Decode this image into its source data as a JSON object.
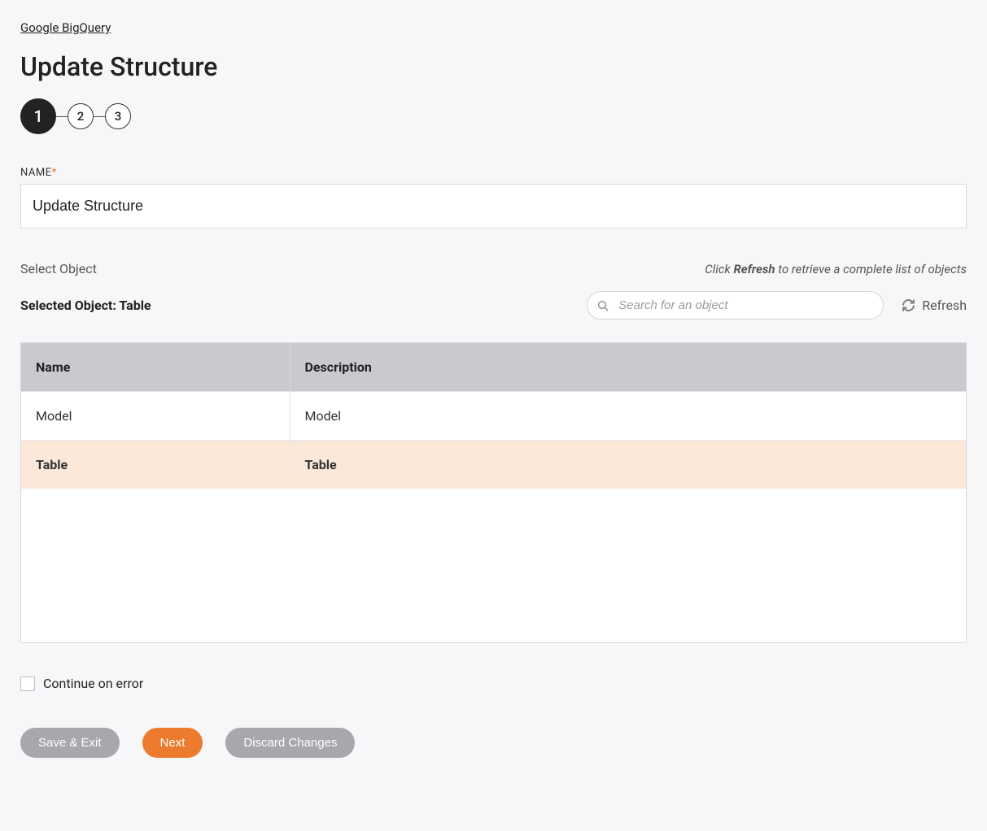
{
  "breadcrumb": "Google BigQuery",
  "page_title": "Update Structure",
  "stepper": {
    "steps": [
      "1",
      "2",
      "3"
    ],
    "active_index": 0
  },
  "name_field": {
    "label": "NAME",
    "value": "Update Structure"
  },
  "select_object": {
    "label": "Select Object",
    "hint_prefix": "Click ",
    "hint_bold": "Refresh",
    "hint_suffix": " to retrieve a complete list of objects",
    "selected_label": "Selected Object: Table"
  },
  "search": {
    "placeholder": "Search for an object"
  },
  "refresh_label": "Refresh",
  "table": {
    "headers": {
      "name": "Name",
      "description": "Description"
    },
    "rows": [
      {
        "name": "Model",
        "description": "Model",
        "selected": false
      },
      {
        "name": "Table",
        "description": "Table",
        "selected": true
      }
    ]
  },
  "continue_on_error": {
    "label": "Continue on error",
    "checked": false
  },
  "buttons": {
    "save_exit": "Save & Exit",
    "next": "Next",
    "discard": "Discard Changes"
  }
}
